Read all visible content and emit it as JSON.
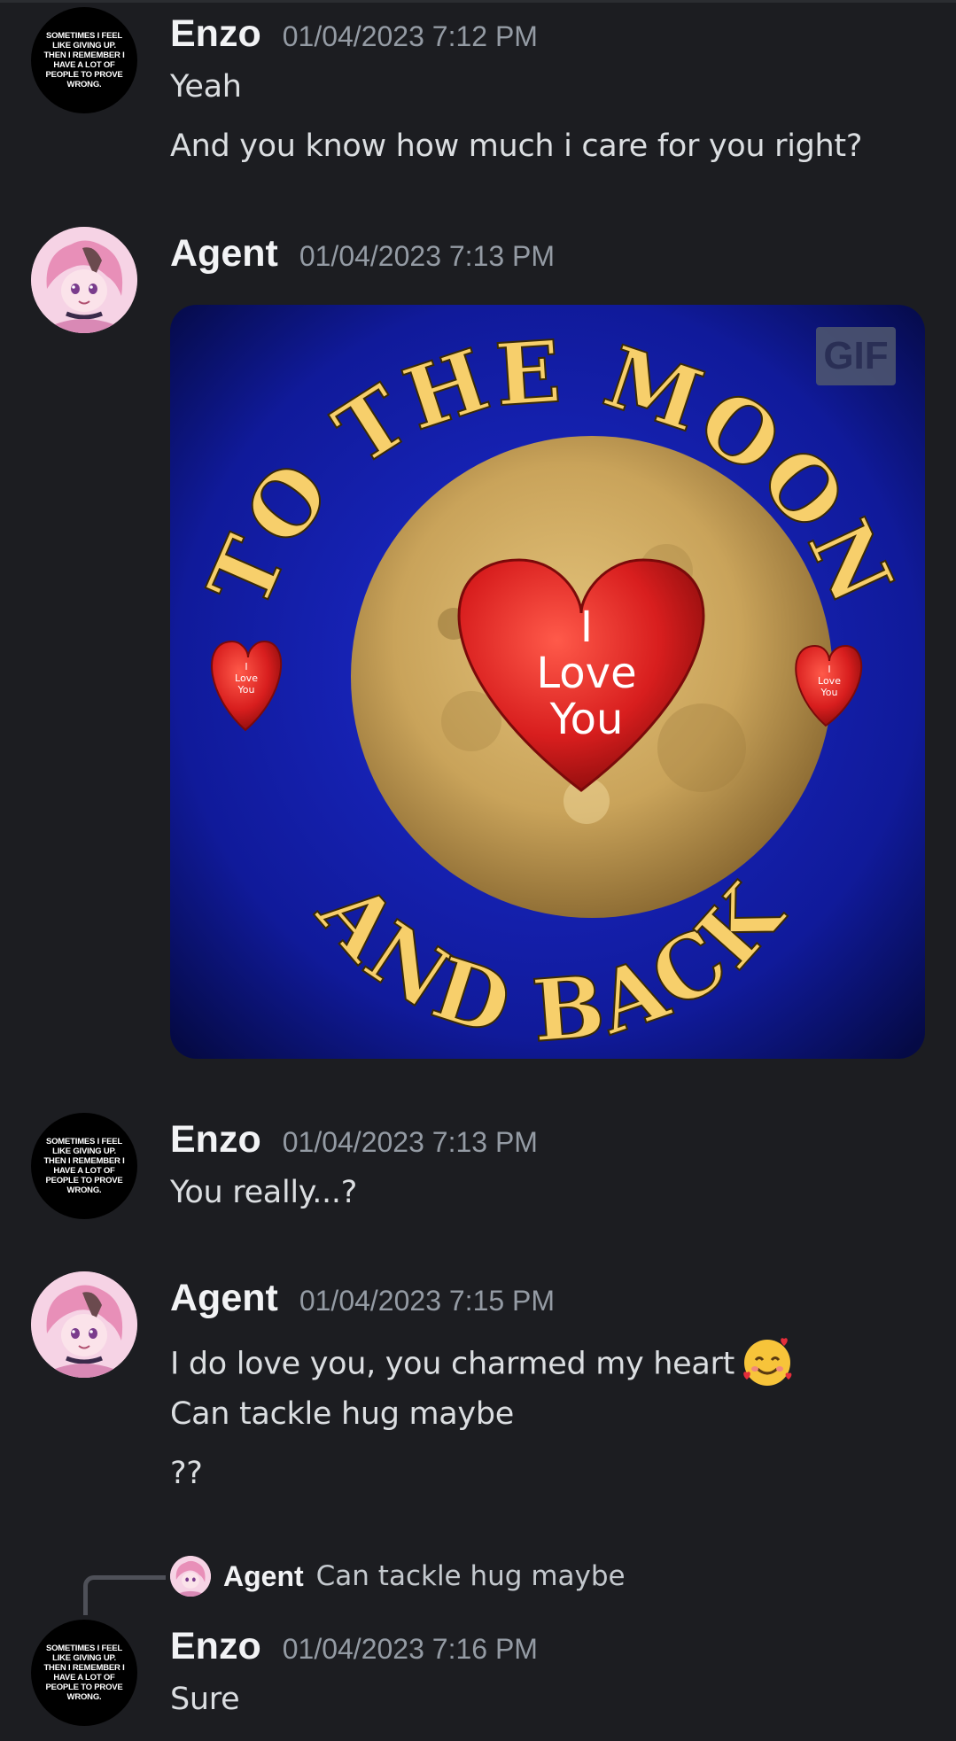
{
  "messages": [
    {
      "author": "Enzo",
      "timestamp": "01/04/2023 7:12 PM",
      "avatar_text": "SOMETIMES I FEEL LIKE GIVING UP. THEN I REMEMBER I HAVE A LOT OF PEOPLE TO PROVE WRONG.",
      "lines": [
        "Yeah",
        "And you know how much i care for you right?"
      ]
    },
    {
      "author": "Agent",
      "timestamp": "01/04/2023 7:13 PM",
      "gif": {
        "badge": "GIF",
        "top_text": "TO THE MOON",
        "bottom_text": "AND BACK",
        "heart_line1": "I",
        "heart_line2": "Love",
        "heart_line3": "You",
        "small_heart_line1": "I",
        "small_heart_line2": "Love",
        "small_heart_line3": "You"
      }
    },
    {
      "author": "Enzo",
      "timestamp": "01/04/2023 7:13 PM",
      "avatar_text": "SOMETIMES I FEEL LIKE GIVING UP. THEN I REMEMBER I HAVE A LOT OF PEOPLE TO PROVE WRONG.",
      "lines": [
        "You really...?"
      ]
    },
    {
      "author": "Agent",
      "timestamp": "01/04/2023 7:15 PM",
      "lines": [
        "I do love you, you charmed my heart",
        "Can tackle hug maybe",
        "??"
      ],
      "emoji": "smiling-face-with-hearts"
    },
    {
      "author": "Enzo",
      "timestamp": "01/04/2023 7:16 PM",
      "avatar_text": "SOMETIMES I FEEL LIKE GIVING UP. THEN I REMEMBER I HAVE A LOT OF PEOPLE TO PROVE WRONG.",
      "reply_to": {
        "author": "Agent",
        "text": "Can tackle hug maybe"
      },
      "lines": [
        "Sure"
      ]
    }
  ],
  "colors": {
    "background": "#1c1d21",
    "username": "#f2f3f5",
    "timestamp": "#949ba4",
    "message_text": "#dbdee1",
    "gif_blue": "#1a22b8",
    "gif_text": "#f7cf6b",
    "heart_red": "#d81e1e"
  }
}
